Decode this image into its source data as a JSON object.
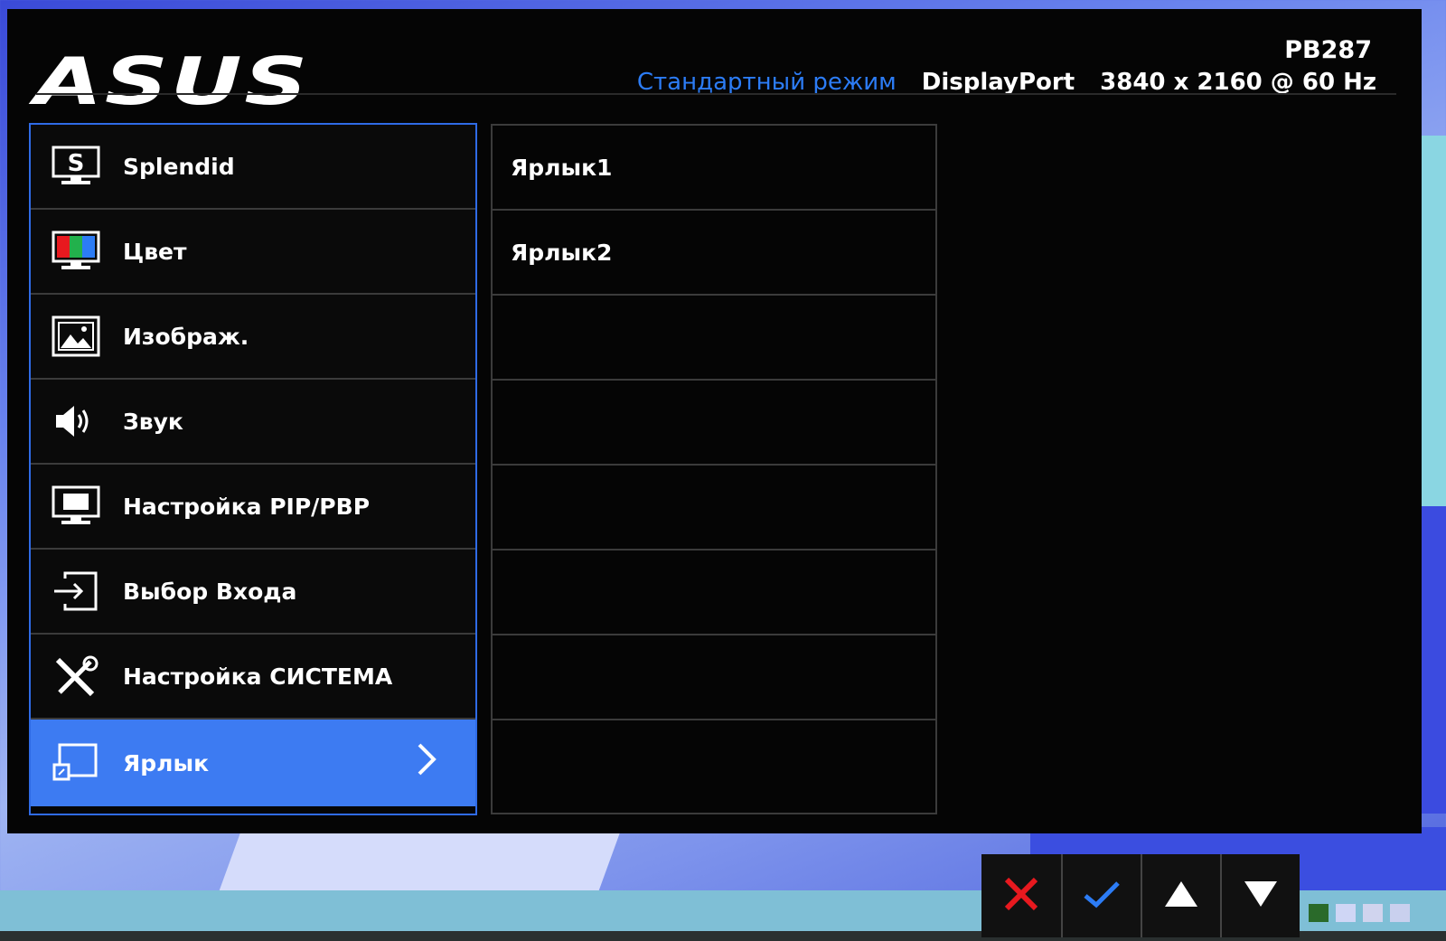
{
  "header": {
    "logo": "ASUS",
    "model": "PB287",
    "mode": "Стандартный режим",
    "input": "DisplayPort",
    "resolution": "3840 x 2160 @ 60 Hz"
  },
  "menu": {
    "items": [
      {
        "label": "Splendid",
        "icon": "splendid-icon"
      },
      {
        "label": "Цвет",
        "icon": "color-icon"
      },
      {
        "label": "Изображ.",
        "icon": "image-icon"
      },
      {
        "label": "Звук",
        "icon": "speaker-icon"
      },
      {
        "label": "Настройка PIP/PBP",
        "icon": "pip-monitor-icon"
      },
      {
        "label": "Выбор Входа",
        "icon": "input-select-icon"
      },
      {
        "label": "Настройка СИСТЕМА",
        "icon": "system-tools-icon"
      },
      {
        "label": "Ярлык",
        "icon": "shortcut-icon",
        "selected": true
      }
    ]
  },
  "submenu": {
    "items": [
      "Ярлык1",
      "Ярлык2",
      "",
      "",
      "",
      "",
      "",
      ""
    ]
  },
  "nav": {
    "buttons": [
      "close-icon",
      "check-icon",
      "up-arrow-icon",
      "down-arrow-icon"
    ]
  },
  "colors": {
    "accent": "#3d7bf2",
    "mode_text": "#2c7cf5",
    "close": "#e8191f",
    "check": "#2c7cf5"
  }
}
